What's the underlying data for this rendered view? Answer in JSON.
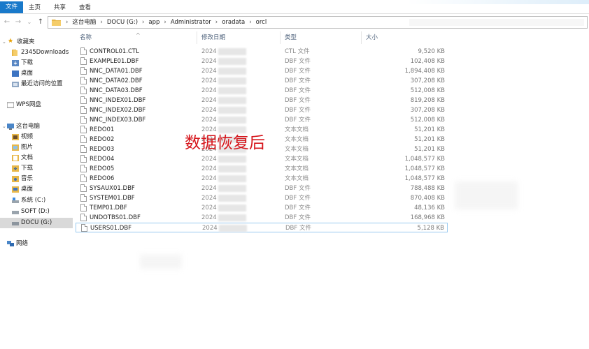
{
  "ribbon": {
    "tabs": [
      "文件",
      "主页",
      "共享",
      "查看"
    ]
  },
  "nav_buttons": {
    "back": "←",
    "forward": "→",
    "down": "⌄",
    "up": "↑"
  },
  "breadcrumb": [
    "这台电脑",
    "DOCU (G:)",
    "app",
    "Administrator",
    "oradata",
    "orcl"
  ],
  "sidebar": {
    "quick_access": "收藏夹",
    "quick_items": [
      "2345Downloads",
      "下载",
      "桌面",
      "最近访问的位置"
    ],
    "wps": "WPS网盘",
    "this_pc": "这台电脑",
    "pc_items": [
      "视频",
      "图片",
      "文档",
      "下载",
      "音乐",
      "桌面",
      "系统 (C:)",
      "SOFT (D:)",
      "DOCU (G:)"
    ],
    "network": "网络"
  },
  "columns": {
    "name": "名称",
    "date": "修改日期",
    "type": "类型",
    "size": "大小"
  },
  "files": [
    {
      "name": "CONTROL01.CTL",
      "date": "2024",
      "type": "CTL 文件",
      "size": "9,520 KB"
    },
    {
      "name": "EXAMPLE01.DBF",
      "date": "2024",
      "type": "DBF 文件",
      "size": "102,408 KB"
    },
    {
      "name": "NNC_DATA01.DBF",
      "date": "2024",
      "type": "DBF 文件",
      "size": "1,894,408 KB"
    },
    {
      "name": "NNC_DATA02.DBF",
      "date": "2024",
      "type": "DBF 文件",
      "size": "307,208 KB"
    },
    {
      "name": "NNC_DATA03.DBF",
      "date": "2024",
      "type": "DBF 文件",
      "size": "512,008 KB"
    },
    {
      "name": "NNC_INDEX01.DBF",
      "date": "2024",
      "type": "DBF 文件",
      "size": "819,208 KB"
    },
    {
      "name": "NNC_INDEX02.DBF",
      "date": "2024",
      "type": "DBF 文件",
      "size": "307,208 KB"
    },
    {
      "name": "NNC_INDEX03.DBF",
      "date": "2024",
      "type": "DBF 文件",
      "size": "512,008 KB"
    },
    {
      "name": "REDO01",
      "date": "2024",
      "type": "文本文档",
      "size": "51,201 KB"
    },
    {
      "name": "REDO02",
      "date": "2024",
      "type": "文本文档",
      "size": "51,201 KB"
    },
    {
      "name": "REDO03",
      "date": "2024",
      "type": "文本文档",
      "size": "51,201 KB"
    },
    {
      "name": "REDO04",
      "date": "2024",
      "type": "文本文档",
      "size": "1,048,577 KB"
    },
    {
      "name": "REDO05",
      "date": "2024",
      "type": "文本文档",
      "size": "1,048,577 KB"
    },
    {
      "name": "REDO06",
      "date": "2024",
      "type": "文本文档",
      "size": "1,048,577 KB"
    },
    {
      "name": "SYSAUX01.DBF",
      "date": "2024",
      "type": "DBF 文件",
      "size": "788,488 KB"
    },
    {
      "name": "SYSTEM01.DBF",
      "date": "2024",
      "type": "DBF 文件",
      "size": "870,408 KB"
    },
    {
      "name": "TEMP01.DBF",
      "date": "2024",
      "type": "DBF 文件",
      "size": "48,136 KB"
    },
    {
      "name": "UNDOTBS01.DBF",
      "date": "2024",
      "type": "DBF 文件",
      "size": "168,968 KB"
    },
    {
      "name": "USERS01.DBF",
      "date": "2024",
      "type": "DBF 文件",
      "size": "5,128 KB"
    }
  ],
  "overlay_text": "数据恢复后",
  "colors": {
    "file_tab": "#1979ca",
    "overlay": "#d6161c",
    "folder": "#e8b84a",
    "selection_border": "#99c9ef"
  }
}
